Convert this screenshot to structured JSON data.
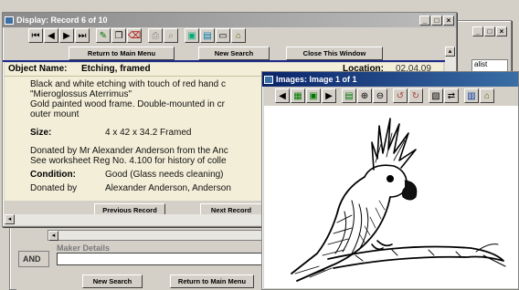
{
  "record_window": {
    "title": "Display: Record 6 of 10",
    "controls": [
      "_",
      "□",
      "×"
    ],
    "nav": {
      "return_main": "Return to Main Menu",
      "new_search": "New Search",
      "close": "Close This Window"
    },
    "object_name_label": "Object Name:",
    "object_name": "Etching, framed",
    "location_label": "Location:",
    "location": "02.04.09",
    "desc1": "Black and white etching with touch of red hand c",
    "desc2": "\"Mieroglossus Aterrimus\"",
    "desc3": "Gold painted wood frame. Double-mounted in cr",
    "desc4": "outer mount",
    "size_label": "Size:",
    "size": "4 x 42 x 34.2 Framed",
    "donated1": "Donated by Mr Alexander Anderson from the Anc",
    "donated2": "See worksheet Reg No. 4.100 for history of colle",
    "condition_label": "Condition:",
    "condition": "Good  (Glass needs cleaning)",
    "donatedby_label": "Donated by",
    "donatedby": "Alexander Anderson, Anderson",
    "prev": "Previous Record",
    "next": "Next Record"
  },
  "search_window": {
    "maker_label": "Maker Details",
    "and_label": "AND",
    "new_search": "New Search",
    "return_main": "Return to Main Menu",
    "right_controls": [
      "_",
      "□",
      "×"
    ],
    "right_field": "alist"
  },
  "image_window": {
    "title": "Images: Image 1 of 1",
    "image": "cockatoo-etching"
  }
}
